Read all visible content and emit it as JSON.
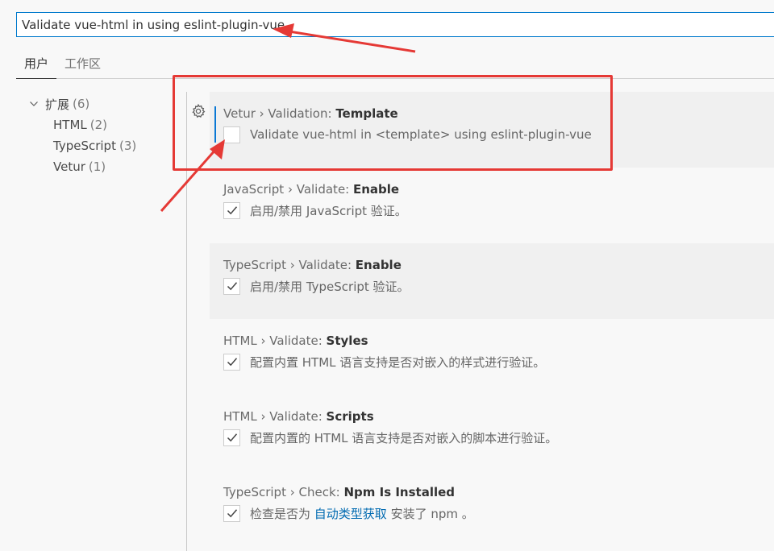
{
  "search": {
    "value": "Validate vue-html in using eslint-plugin-vue"
  },
  "tabs": [
    {
      "label": "用户",
      "active": true
    },
    {
      "label": "工作区",
      "active": false
    }
  ],
  "toc": {
    "group": {
      "label": "扩展",
      "count": "(6)"
    },
    "items": [
      {
        "label": "HTML",
        "count": "(2)"
      },
      {
        "label": "TypeScript",
        "count": "(3)"
      },
      {
        "label": "Vetur",
        "count": "(1)"
      }
    ]
  },
  "settings": [
    {
      "category": "Vetur › Validation: ",
      "name": "Template",
      "checked": false,
      "description": "Validate vue-html in <template> using eslint-plugin-vue"
    },
    {
      "category": "JavaScript › Validate: ",
      "name": "Enable",
      "checked": true,
      "description": "启用/禁用 JavaScript 验证。"
    },
    {
      "category": "TypeScript › Validate: ",
      "name": "Enable",
      "checked": true,
      "description": "启用/禁用 TypeScript 验证。"
    },
    {
      "category": "HTML › Validate: ",
      "name": "Styles",
      "checked": true,
      "description": "配置内置 HTML 语言支持是否对嵌入的样式进行验证。"
    },
    {
      "category": "HTML › Validate: ",
      "name": "Scripts",
      "checked": true,
      "description": "配置内置的 HTML 语言支持是否对嵌入的脚本进行验证。"
    },
    {
      "category": "TypeScript › Check: ",
      "name": "Npm Is Installed",
      "checked": true,
      "description_prefix": "检查是否为 ",
      "description_link": "自动类型获取",
      "description_suffix": " 安装了 npm 。"
    }
  ],
  "colors": {
    "accent": "#007acc",
    "annotation": "#e53935",
    "link": "#006ab1"
  },
  "icons": {
    "toc_chevron": "chevron-down-icon",
    "setting_gear": "gear-icon",
    "check": "check-icon"
  }
}
